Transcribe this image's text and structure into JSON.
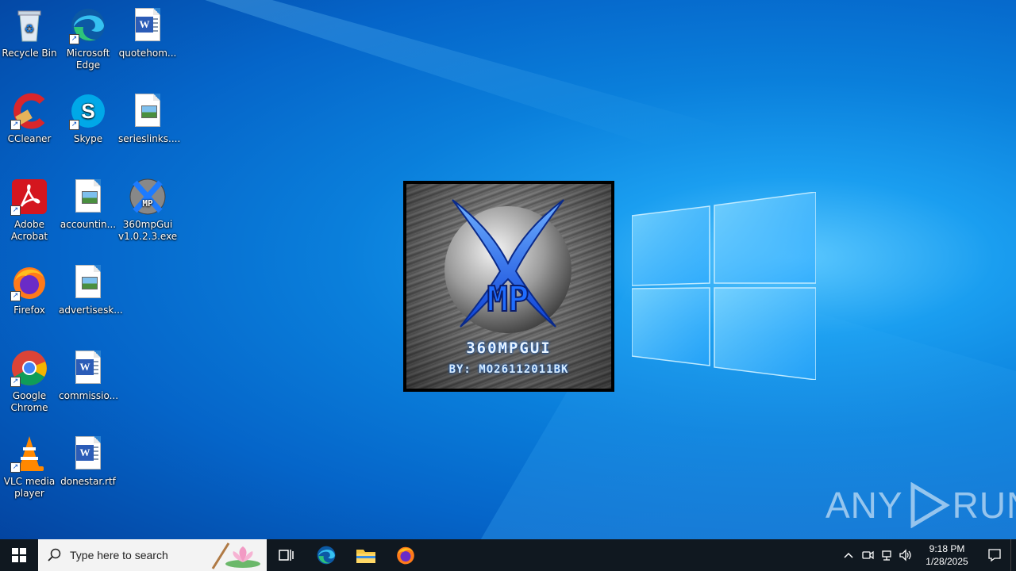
{
  "desktop": {
    "icons": [
      {
        "label": "Recycle Bin"
      },
      {
        "label": "Microsoft Edge"
      },
      {
        "label": "quotehom..."
      },
      {
        "label": "CCleaner"
      },
      {
        "label": "Skype"
      },
      {
        "label": "serieslinks...."
      },
      {
        "label": "Adobe Acrobat"
      },
      {
        "label": "accountin..."
      },
      {
        "label": "360mpGui v1.0.2.3.exe"
      },
      {
        "label": "Firefox"
      },
      {
        "label": "advertisesk..."
      },
      {
        "label": "Google Chrome"
      },
      {
        "label": "commissio..."
      },
      {
        "label": "VLC media player"
      },
      {
        "label": "donestar.rtf"
      }
    ]
  },
  "splash": {
    "title": "360MPGUI",
    "subtitle": "BY: MO26112011BK",
    "logo_letters": "MP"
  },
  "watermark": {
    "text": "ANY",
    "text2": "RUN"
  },
  "taskbar": {
    "search_placeholder": "Type here to search",
    "clock_time": "9:18 PM",
    "clock_date": "1/28/2025"
  },
  "colors": {
    "accent_blue": "#1d7bff",
    "taskbar_bg": "#101820"
  }
}
